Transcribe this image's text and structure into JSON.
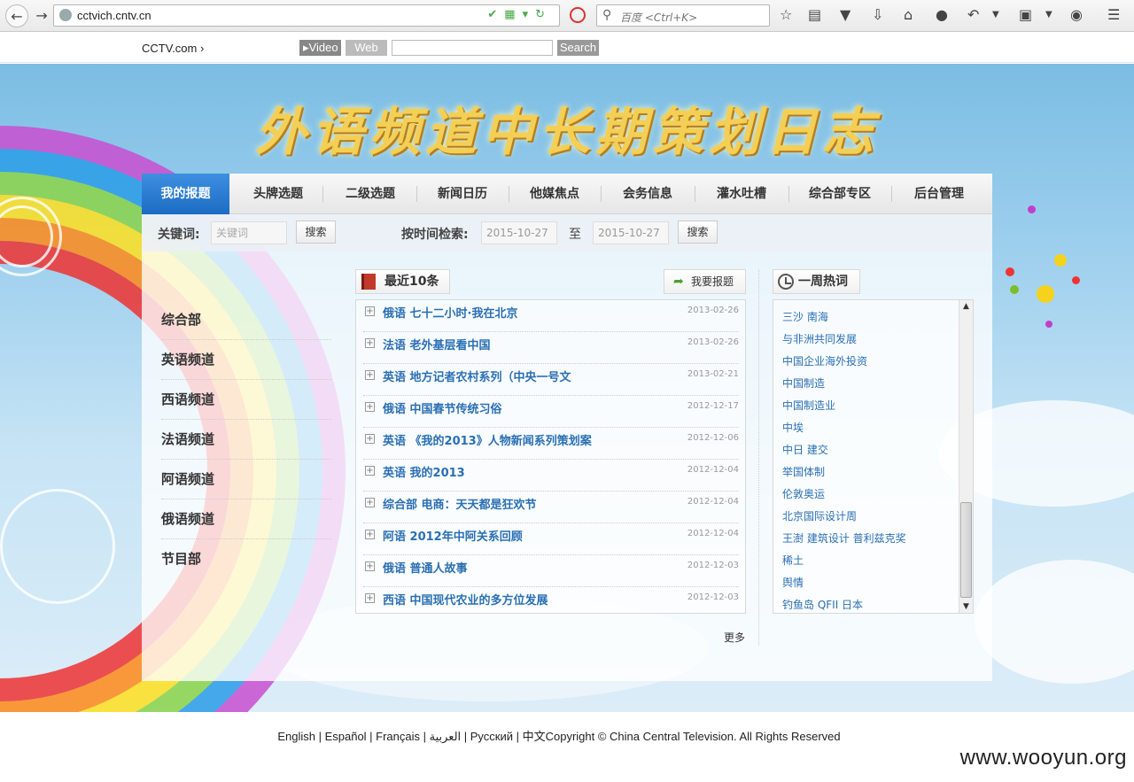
{
  "browser": {
    "url": "cctvich.cntv.cn",
    "search_placeholder": "百度 <Ctrl+K>"
  },
  "cctv_bar": {
    "home_link": "CCTV.com",
    "video_tab": "Video",
    "web_tab": "Web",
    "search_button": "Search"
  },
  "banner": {
    "title": "外语频道中长期策划日志"
  },
  "nav": {
    "items": [
      "我的报题",
      "头牌选题",
      "二级选题",
      "新闻日历",
      "他媒焦点",
      "会务信息",
      "灌水吐槽",
      "综合部专区",
      "后台管理"
    ],
    "active_index": 0
  },
  "search": {
    "keyword_label": "关键词:",
    "keyword_placeholder": "关键词",
    "keyword_button": "搜索",
    "time_label": "按时间检索:",
    "date_from": "2015-10-27",
    "to_label": "至",
    "date_to": "2015-10-27",
    "time_button": "搜索"
  },
  "categories": [
    "综合部",
    "英语频道",
    "西语频道",
    "法语频道",
    "阿语频道",
    "俄语频道",
    "节目部"
  ],
  "latest": {
    "title": "最近10条",
    "report_button": "我要报题",
    "more": "更多",
    "items": [
      {
        "title": "俄语 七十二小时·我在北京",
        "date": "2013-02-26"
      },
      {
        "title": "法语 老外基层看中国",
        "date": "2013-02-26"
      },
      {
        "title": "英语 地方记者农村系列（中央一号文",
        "date": "2013-02-21"
      },
      {
        "title": "俄语 中国春节传统习俗",
        "date": "2012-12-17"
      },
      {
        "title": "英语 《我的2013》人物新闻系列策划案",
        "date": "2012-12-06"
      },
      {
        "title": "英语 我的2013",
        "date": "2012-12-04"
      },
      {
        "title": "综合部 电商：天天都是狂欢节",
        "date": "2012-12-04"
      },
      {
        "title": "阿语 2012年中阿关系回顾",
        "date": "2012-12-04"
      },
      {
        "title": "俄语 普通人故事",
        "date": "2012-12-03"
      },
      {
        "title": "西语 中国现代农业的多方位发展",
        "date": "2012-12-03"
      }
    ]
  },
  "hot": {
    "title": "一周热词",
    "items": [
      "三沙 南海",
      "与非洲共同发展",
      "中国企业海外投资",
      "中国制造",
      "中国制造业",
      "中埃",
      "中日 建交",
      "举国体制",
      "伦敦奥运",
      "北京国际设计周",
      "王澍 建筑设计 普利兹克奖",
      "稀土",
      "舆情",
      "钓鱼岛 QFII 日本"
    ]
  },
  "footer": {
    "text": "English | Español | Français | العربية | Русский | 中文Copyright © China Central Television. All Rights Reserved",
    "watermark": "www.wooyun.org"
  },
  "colors": {
    "nav_active": "#1b6cc3",
    "link": "#2a6fb3",
    "banner_title": "#f3cf55"
  }
}
